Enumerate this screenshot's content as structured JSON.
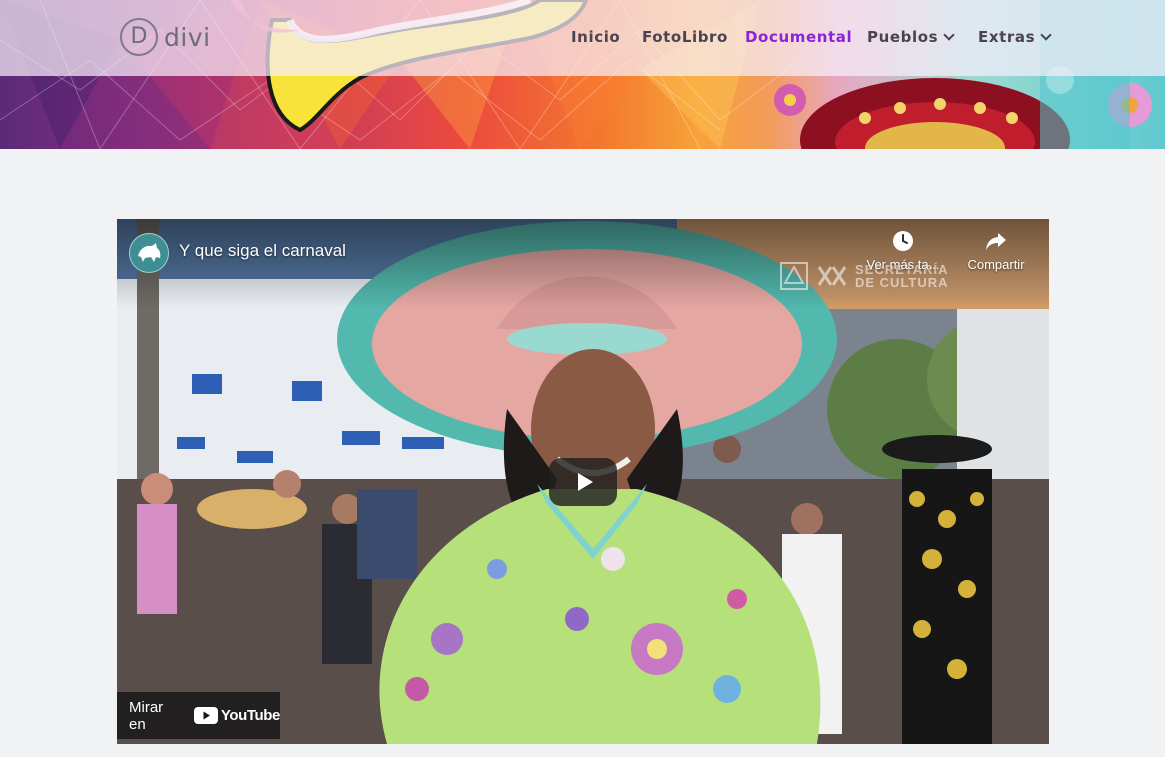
{
  "site": {
    "logo_letter": "D",
    "logo_text": "divi"
  },
  "nav": {
    "items": [
      {
        "label": "Inicio",
        "active": false,
        "dropdown": false
      },
      {
        "label": "FotoLibro",
        "active": false,
        "dropdown": false
      },
      {
        "label": "Documental",
        "active": true,
        "dropdown": false
      },
      {
        "label": "Pueblos",
        "active": false,
        "dropdown": true
      },
      {
        "label": "Extras",
        "active": false,
        "dropdown": true
      }
    ]
  },
  "video": {
    "title": "Y que siga el carnaval",
    "watch_later_label": "Ver más ta...",
    "share_label": "Compartir",
    "watermark_text_1": "SECRETARÍA",
    "watermark_text_2": "DE CULTURA",
    "watch_on_label": "Mirar en",
    "youtube_word": "YouTube"
  },
  "colors": {
    "nav_active": "#8a24d8",
    "nav_default": "#4a4450",
    "page_background": "#f1f2f4"
  }
}
